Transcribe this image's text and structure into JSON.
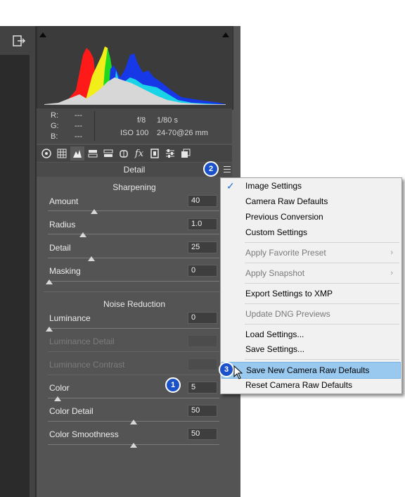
{
  "readout": {
    "r_label": "R:",
    "g_label": "G:",
    "b_label": "B:",
    "r_value": "---",
    "g_value": "---",
    "b_value": "---",
    "aperture": "f/8",
    "shutter": "1/80 s",
    "iso": "ISO 100",
    "lens": "24-70@26 mm"
  },
  "tabs": [
    "basic-icon",
    "tone-curve-icon",
    "detail-icon",
    "hsl-icon",
    "split-toning-icon",
    "lens-corrections-icon",
    "effects-icon",
    "camera-calibration-icon",
    "presets-icon",
    "snapshots-icon"
  ],
  "panel": {
    "title": "Detail"
  },
  "sharpening": {
    "title": "Sharpening",
    "amount": {
      "label": "Amount",
      "value": "40"
    },
    "radius": {
      "label": "Radius",
      "value": "1.0"
    },
    "detail": {
      "label": "Detail",
      "value": "25"
    },
    "masking": {
      "label": "Masking",
      "value": "0"
    }
  },
  "noise": {
    "title": "Noise Reduction",
    "luminance": {
      "label": "Luminance",
      "value": "0"
    },
    "luminance_detail": {
      "label": "Luminance Detail",
      "value": ""
    },
    "luminance_contrast": {
      "label": "Luminance Contrast",
      "value": ""
    },
    "color": {
      "label": "Color",
      "value": "5"
    },
    "color_detail": {
      "label": "Color Detail",
      "value": "50"
    },
    "color_smoothness": {
      "label": "Color Smoothness",
      "value": "50"
    }
  },
  "badges": {
    "one": "1",
    "two": "2",
    "three": "3"
  },
  "menu": {
    "image_settings": "Image Settings",
    "camera_raw_defaults": "Camera Raw Defaults",
    "previous_conversion": "Previous Conversion",
    "custom_settings": "Custom Settings",
    "apply_favorite_preset": "Apply Favorite Preset",
    "apply_snapshot": "Apply Snapshot",
    "export_settings": "Export Settings to XMP",
    "update_dng": "Update DNG Previews",
    "load_settings": "Load Settings...",
    "save_settings": "Save Settings...",
    "save_new_defaults": "Save New Camera Raw Defaults",
    "reset_defaults": "Reset Camera Raw Defaults",
    "checkmark": "✓",
    "submenu_arrow": "›"
  },
  "colors": {
    "badge": "#1c52c9",
    "menu_highlight": "#99c9ef",
    "panel": "#545454"
  }
}
